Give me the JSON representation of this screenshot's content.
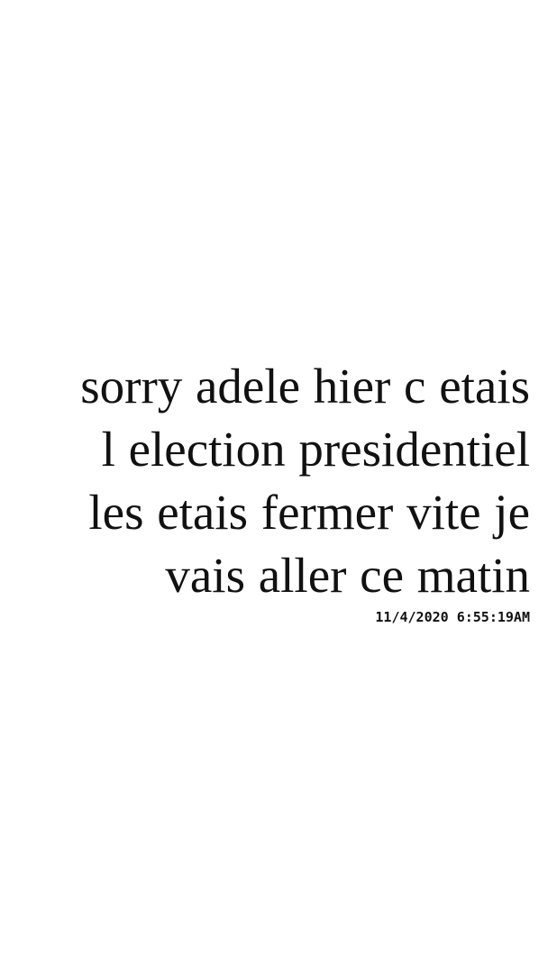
{
  "message": {
    "lines": [
      "sorry adele hier c etais",
      "l election presidentiel",
      "les etais fermer vite je",
      "vais aller ce matin"
    ],
    "timestamp": "11/4/2020 6:55:19AM"
  }
}
